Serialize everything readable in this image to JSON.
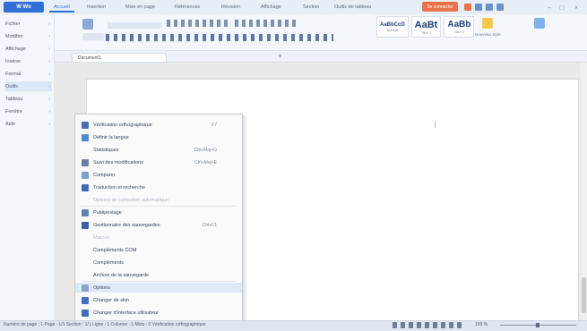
{
  "titlebar": {
    "app_button": "W Wo",
    "tabs": [
      "Accueil",
      "Insertion",
      "Mise en page",
      "Références",
      "Révision",
      "Affichage",
      "Section",
      "Outils de tableau"
    ],
    "red_button": "Se connecter",
    "colors": {
      "accent": "#2f6fd6",
      "red": "#e8734a",
      "bg": "#e8eef6"
    }
  },
  "ribbon": {
    "styles": [
      {
        "big": "AaBbCcD",
        "small": "Normal"
      },
      {
        "big": "AaBt",
        "small": "Titre 1"
      },
      {
        "big": "AaBb",
        "small": "Titre 2"
      }
    ],
    "right_label": "Nouveau style"
  },
  "doc_tab": {
    "label": "Document1"
  },
  "left_pane": {
    "items": [
      "Fichier",
      "Modifier",
      "Affichage",
      "Insérer",
      "Format",
      "Outils",
      "Tableau",
      "Fenêtre",
      "Aide"
    ]
  },
  "menu": {
    "items": [
      {
        "label": "Vérification orthographique",
        "shortcut": "F7",
        "icon": "spellcheck-icon",
        "state": "normal"
      },
      {
        "label": "Définir la langue",
        "shortcut": "",
        "icon": "language-icon",
        "state": "normal"
      },
      {
        "label": "Statistiques",
        "shortcut": "Ctrl+Maj+G",
        "icon": "",
        "state": "normal"
      },
      {
        "label": "Suivi des modifications",
        "shortcut": "Ctrl+Maj+E",
        "icon": "track-changes-icon",
        "state": "normal"
      },
      {
        "label": "Comparer",
        "shortcut": "",
        "icon": "compare-icon",
        "state": "normal"
      },
      {
        "label": "Traduction et recherche",
        "shortcut": "",
        "icon": "translate-icon",
        "state": "normal"
      },
      {
        "label": "Options de correction automatique",
        "shortcut": "",
        "icon": "",
        "state": "disabled"
      },
      {
        "label": "Publipostage",
        "shortcut": "",
        "icon": "mailmerge-icon",
        "state": "normal"
      },
      {
        "label": "Gestionnaire des sauvegardes",
        "shortcut": "Ctrl+F1",
        "icon": "backup-icon",
        "state": "normal"
      },
      {
        "label": "Macros",
        "shortcut": "",
        "icon": "",
        "state": "disabled"
      },
      {
        "label": "Compléments COM",
        "shortcut": "",
        "icon": "",
        "state": "normal"
      },
      {
        "label": "Compléments",
        "shortcut": "",
        "icon": "",
        "state": "normal"
      },
      {
        "label": "Archive de la sauvegarde",
        "shortcut": "",
        "icon": "",
        "state": "normal"
      },
      {
        "label": "Options",
        "shortcut": "",
        "icon": "options-icon",
        "state": "highlight"
      },
      {
        "label": "Changer de skin",
        "shortcut": "",
        "icon": "skin-icon",
        "state": "normal"
      },
      {
        "label": "Changer d'interface utilisateur",
        "shortcut": "",
        "icon": "interface-icon",
        "state": "normal"
      }
    ]
  },
  "statusbar": {
    "left": "Numéro de page : 1   Page : 1/1   Section : 1/1   Ligne : 1   Colonne : 1   Mots : 0   Vérification orthographique",
    "zoom": "100 %"
  }
}
